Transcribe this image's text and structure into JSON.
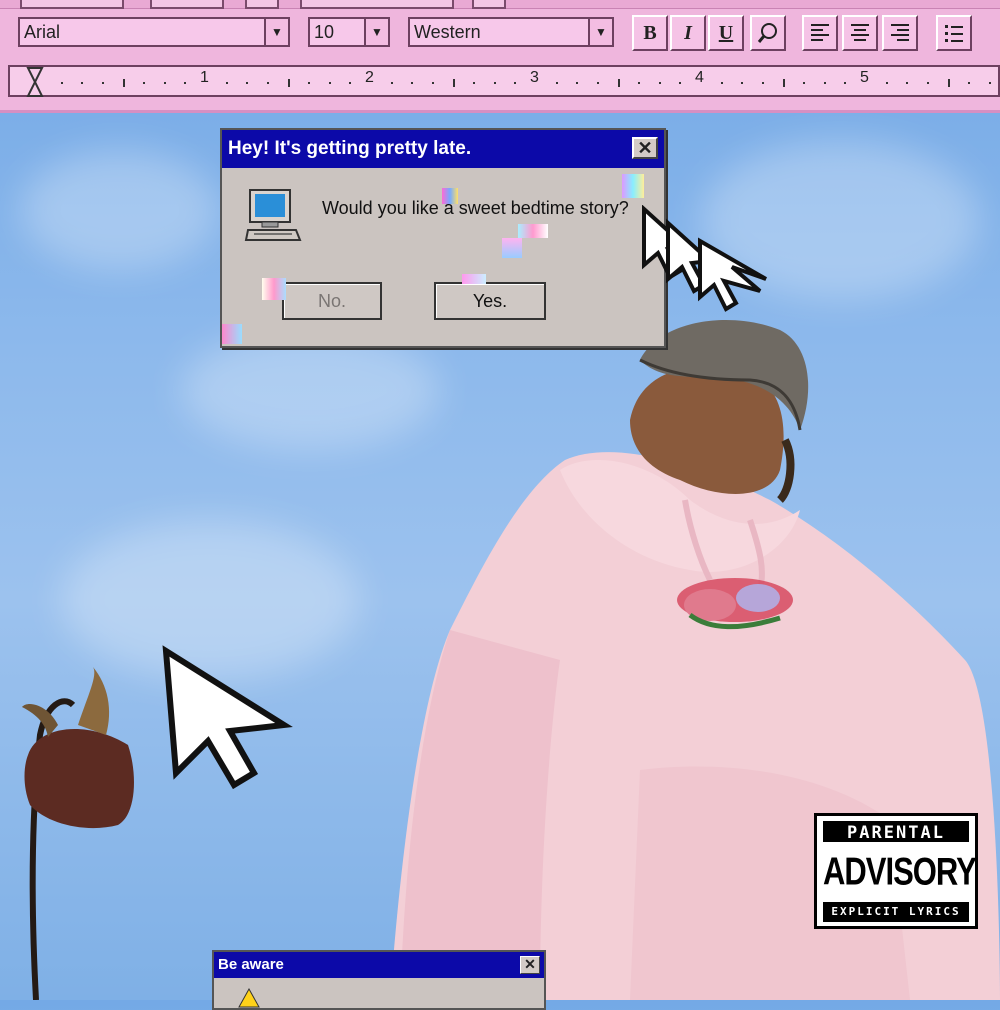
{
  "toolbar": {
    "font_name": "Arial",
    "font_size": "10",
    "script": "Western",
    "buttons": {
      "bold": "B",
      "italic": "I",
      "underline": "U"
    },
    "icons": [
      "highlight-icon",
      "align-left-icon",
      "align-center-icon",
      "align-right-icon",
      "bullets-icon",
      "hourglass-icon"
    ],
    "ruler_numbers": [
      "1",
      "2",
      "3",
      "4",
      "5"
    ]
  },
  "dialog": {
    "title": "Hey! It's getting pretty late.",
    "close": "✕",
    "message": "Would you like a sweet bedtime story?",
    "no_label": "No.",
    "yes_label": "Yes.",
    "icon": "computer-icon"
  },
  "dialog2": {
    "title": "Be aware",
    "close": "✕"
  },
  "advisory": {
    "top": "PARENTAL",
    "middle": "ADVISORY",
    "bottom": "EXPLICIT LYRICS"
  },
  "colors": {
    "sky": "#8db9ec",
    "toolbar": "#efb6dd",
    "title_bar": "#0c09a8",
    "dialog": "#cbc4c0",
    "hoodie": "#f3cfd6"
  }
}
